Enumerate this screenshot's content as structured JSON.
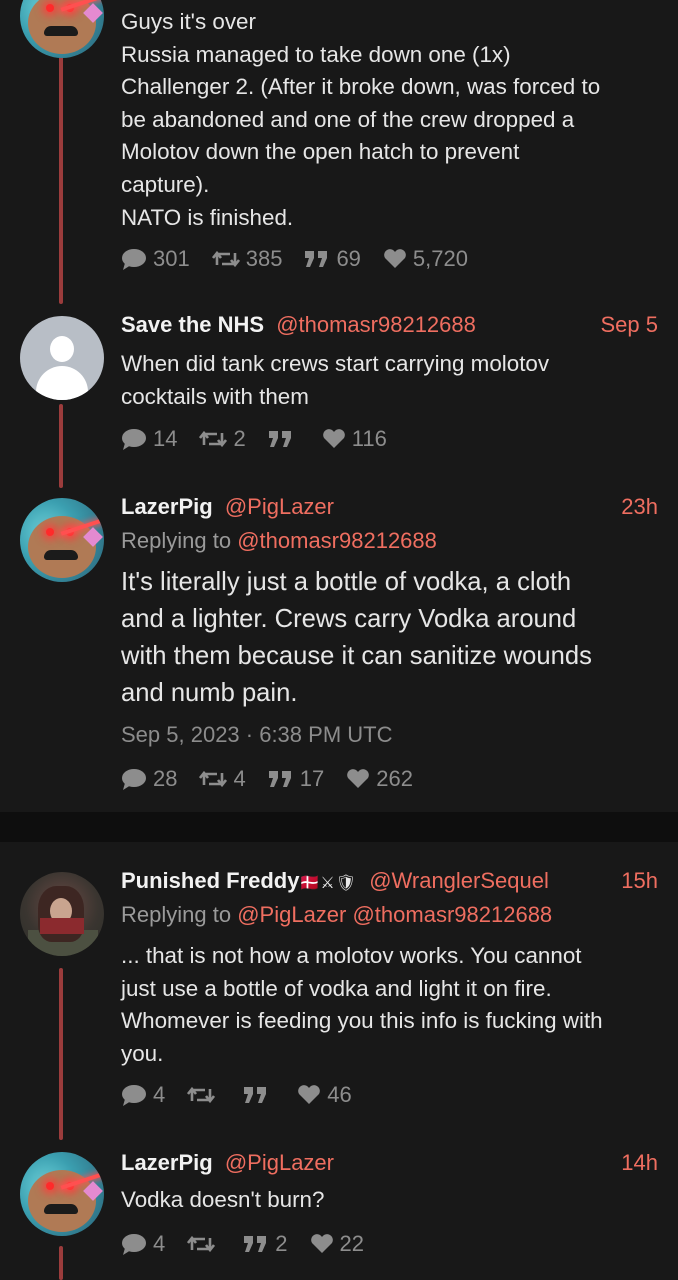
{
  "tweets": [
    {
      "text_lines": [
        "Guys it's over",
        "Russia managed to take down one (1x)",
        "Challenger 2. (After it broke down, was forced to",
        "be abandoned and one of the crew dropped a",
        "Molotov down the open hatch to prevent",
        "capture).",
        "NATO is finished."
      ],
      "stats": {
        "replies": "301",
        "retweets": "385",
        "quotes": "69",
        "likes": "5,720"
      }
    },
    {
      "name": "Save the NHS",
      "handle": "@thomasr98212688",
      "time": "Sep 5",
      "text_lines": [
        "When did tank crews start carrying molotov",
        "cocktails with them"
      ],
      "stats": {
        "replies": "14",
        "retweets": "2",
        "quotes": "",
        "likes": "116"
      }
    },
    {
      "name": "LazerPig",
      "handle": "@PigLazer",
      "time": "23h",
      "reply_prefix": "Replying to",
      "reply_to": "@thomasr98212688",
      "text_lines": [
        "It's literally just a bottle of vodka, a cloth",
        "and a lighter. Crews carry Vodka around",
        "with them because it can sanitize wounds",
        "and numb pain."
      ],
      "timestamp": "Sep 5, 2023 · 6:38 PM UTC",
      "stats": {
        "replies": "28",
        "retweets": "4",
        "quotes": "17",
        "likes": "262"
      }
    },
    {
      "name": "Punished Freddy",
      "name_flags": "🇩🇰⚔🛡",
      "handle": "@WranglerSequel",
      "time": "15h",
      "reply_prefix": "Replying to",
      "reply_to": "@PigLazer @thomasr98212688",
      "text_lines": [
        "... that is not how a molotov works. You cannot",
        "just use a bottle of vodka and light it on fire.",
        "Whomever is feeding you this info is fucking with",
        "you."
      ],
      "stats": {
        "replies": "4",
        "retweets": "",
        "quotes": "",
        "likes": "46"
      }
    },
    {
      "name": "LazerPig",
      "handle": "@PigLazer",
      "time": "14h",
      "text_lines": [
        "Vodka doesn't burn?"
      ],
      "stats": {
        "replies": "4",
        "retweets": "",
        "quotes": "2",
        "likes": "22"
      }
    }
  ],
  "icons": {
    "reply": "speech-bubble-icon",
    "retweet": "retweet-icon",
    "quote": "quote-icon",
    "like": "heart-icon"
  },
  "colors": {
    "background": "#181818",
    "accent": "#ef6e60",
    "thread_line": "#9b3c3c",
    "muted": "#8d8d8d"
  }
}
